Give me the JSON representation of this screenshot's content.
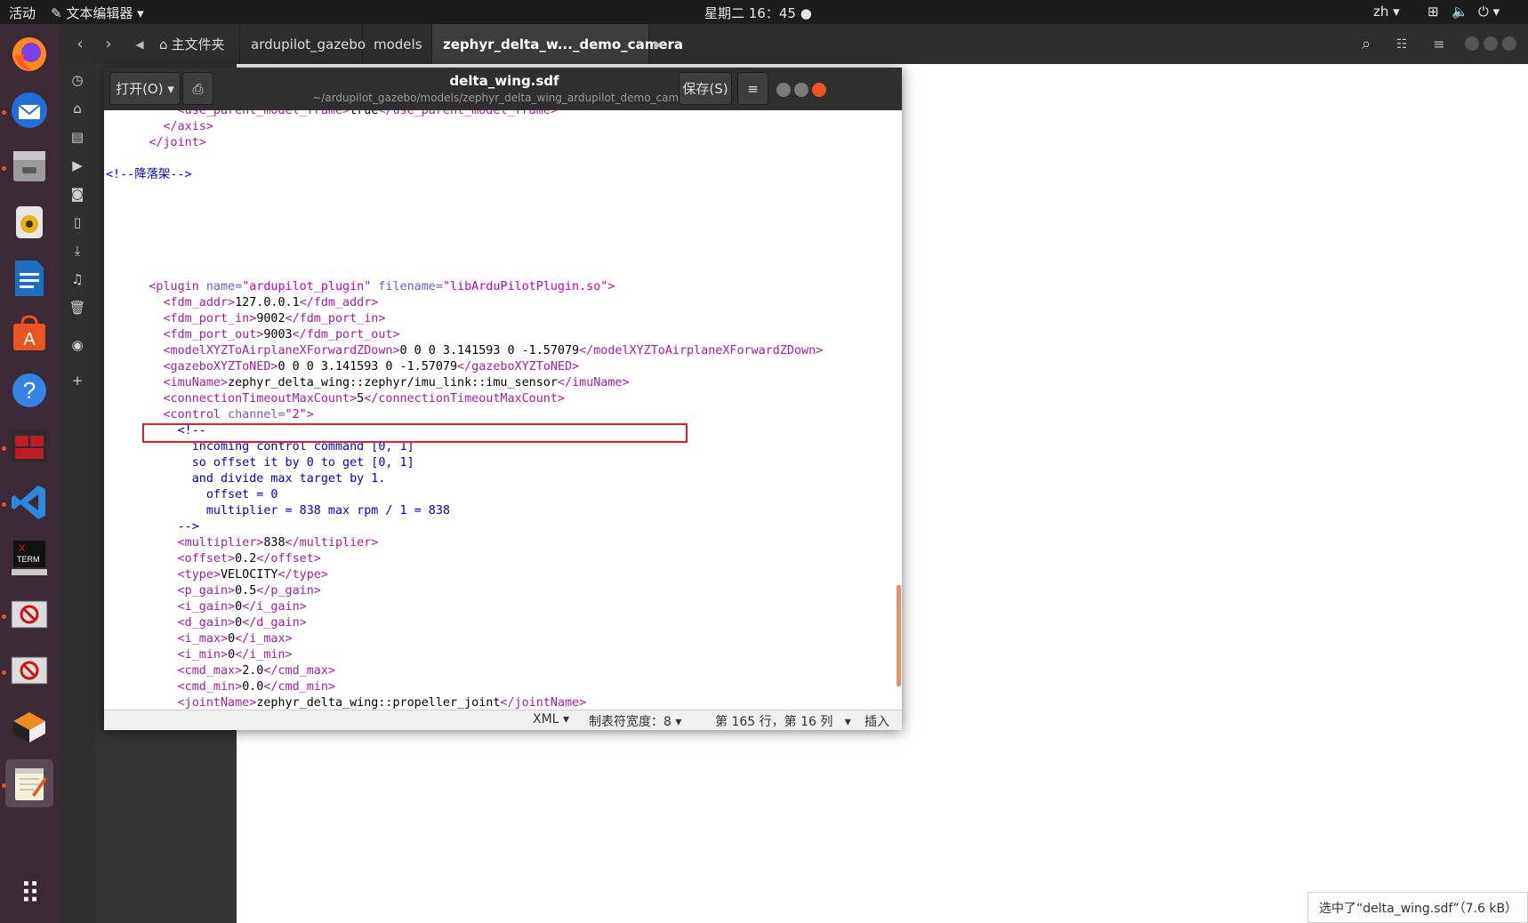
{
  "topbar": {
    "activities": "活动",
    "app_menu": "文本编辑器",
    "clock": "星期二 16：45",
    "lang": "zh"
  },
  "dock": {
    "items": [
      {
        "name": "firefox-icon",
        "glyph": "🦊"
      },
      {
        "name": "thunderbird-icon",
        "glyph": "✉"
      },
      {
        "name": "files-icon",
        "glyph": "🗄"
      },
      {
        "name": "rhythmbox-icon",
        "glyph": "🔊"
      },
      {
        "name": "libreoffice-writer-icon",
        "glyph": "📄"
      },
      {
        "name": "software-center-icon",
        "glyph": "A"
      },
      {
        "name": "help-icon",
        "glyph": "?"
      },
      {
        "name": "terminal-icon",
        "glyph": "▣"
      },
      {
        "name": "vscode-icon",
        "glyph": "⟨⟩"
      },
      {
        "name": "xterm-icon",
        "glyph": "X"
      },
      {
        "name": "blocked-app-icon",
        "glyph": "⊘"
      },
      {
        "name": "blocked-app-icon-2",
        "glyph": "⊘"
      },
      {
        "name": "3d-box-icon",
        "glyph": "▰"
      },
      {
        "name": "text-editor-icon",
        "glyph": "📝"
      }
    ],
    "apps_grid": "⠿"
  },
  "filemanager": {
    "breadcrumbs": [
      "主文件夹",
      "ardupilot_gazebo",
      "models",
      "zephyr_delta_w..._demo_camera"
    ]
  },
  "gedit": {
    "open_label": "打开(O)",
    "save_label": "保存(S)",
    "title": "delta_wing.sdf",
    "subtitle": "~/ardupilot_gazebo/models/zephyr_delta_wing_ardupilot_demo_camera",
    "menu_glyph": "≡"
  },
  "statusbar": {
    "language": "XML",
    "tab_width": "制表符宽度：8",
    "position": "第 165 行，第 16 列",
    "mode": "插入"
  },
  "toast": "选中了“delta_wing.sdf”（7.6 kB）",
  "colors": {
    "accent": "#e95420",
    "highlight_box": "#e02020",
    "tag": "#a020a0",
    "comment": "#0000cc"
  }
}
